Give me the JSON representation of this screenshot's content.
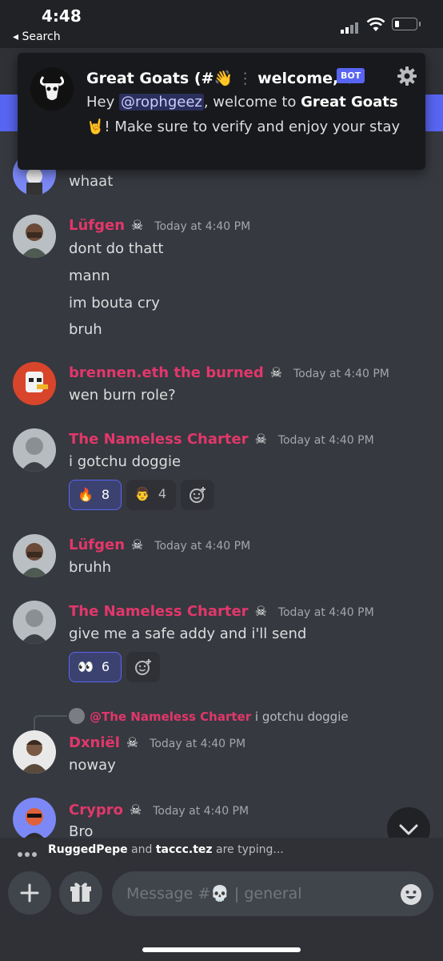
{
  "status": {
    "time": "4:48",
    "back": "◂ Search"
  },
  "notification": {
    "server": "Great Goats (#👋",
    "channel": "welcome, G...",
    "badge": "BOT",
    "body_prefix": "Hey ",
    "mention": "@rophgeez",
    "body_mid": ", welcome to ",
    "server_bold": "Great Goats",
    "body_suffix": " 🤘! Make sure to verify and enjoy your stay"
  },
  "messages": {
    "top_line": "whaat",
    "m1": {
      "user": "Lüfgen",
      "skull": "☠",
      "time": "Today at 4:40 PM",
      "lines": [
        "dont do thatt",
        "mann",
        "im bouta cry",
        "bruh"
      ]
    },
    "m2": {
      "user": "brennen.eth the burned",
      "skull": "☠",
      "time": "Today at 4:40 PM",
      "line": "wen burn role?"
    },
    "m3": {
      "user": "The Nameless Charter",
      "skull": "☠",
      "time": "Today at 4:40 PM",
      "line": "i gotchu doggie",
      "reactions": [
        {
          "emoji": "🔥",
          "count": "8"
        },
        {
          "emoji": "👨",
          "count": "4"
        }
      ]
    },
    "m4": {
      "user": "Lüfgen",
      "skull": "☠",
      "time": "Today at 4:40 PM",
      "line": "bruhh"
    },
    "m5": {
      "user": "The Nameless Charter",
      "skull": "☠",
      "time": "Today at 4:40 PM",
      "line": "give me a safe addy and i'll send",
      "reactions": [
        {
          "emoji": "👀",
          "count": "6"
        }
      ]
    },
    "reply": {
      "name": "@The Nameless Charter",
      "text": "i gotchu doggie"
    },
    "m6": {
      "user": "Dxniël",
      "skull": "☠",
      "time": "Today at 4:40 PM",
      "line": "noway"
    },
    "m7": {
      "user": "Crypro",
      "skull": "☠",
      "time": "Today at 4:40 PM",
      "line": "Bro"
    }
  },
  "typing": {
    "user1": "RuggedPepe",
    "and": " and ",
    "user2": "taccc.tez",
    "suffix": " are typing..."
  },
  "composer": {
    "placeholder": "Message #💀 | general"
  },
  "colors": {
    "background": "#36393f",
    "username": "#e2376b",
    "accent": "#5865f2"
  }
}
